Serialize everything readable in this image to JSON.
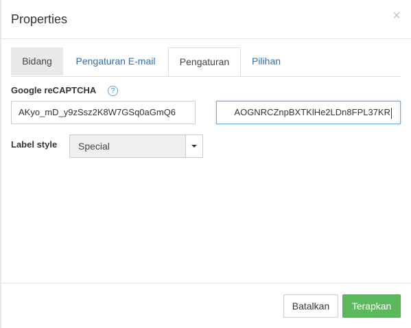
{
  "dialog": {
    "title": "Properties",
    "close_symbol": "×"
  },
  "tabs": [
    {
      "label": "Bidang",
      "state": "inactive-shaded"
    },
    {
      "label": "Pengaturan E-mail",
      "state": "link"
    },
    {
      "label": "Pengaturan",
      "state": "active"
    },
    {
      "label": "Pilihan",
      "state": "link"
    }
  ],
  "recaptcha": {
    "label": "Google reCAPTCHA",
    "help_symbol": "?",
    "site_key_value": "AKyo_mD_y9zSsz2K8W7GSq0aGmQ6",
    "secret_key_value": "AOGNRCZnpBXTKlHe2LDn8FPL37KR"
  },
  "label_style": {
    "label": "Label style",
    "selected": "Special"
  },
  "footer": {
    "cancel_label": "Batalkan",
    "apply_label": "Terapkan"
  },
  "colors": {
    "link": "#2a6fb0",
    "apply_button": "#5cb85c",
    "focus_border": "#6fa9d9"
  },
  "icons": {
    "close": "close-icon",
    "help": "help-icon",
    "dropdown": "chevron-down-icon"
  }
}
